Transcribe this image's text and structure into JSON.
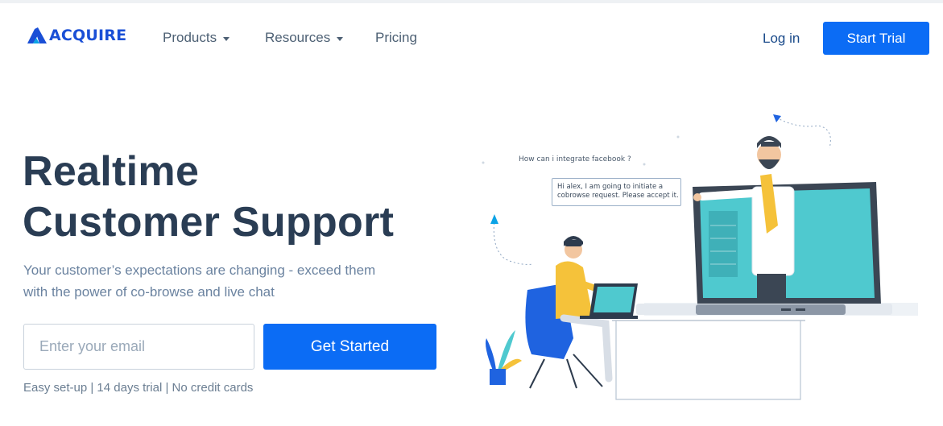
{
  "brand": {
    "logo_text": "ACQUIRE",
    "logo_icon": "acquire-logo-mark",
    "color": "#1a4fd6"
  },
  "nav": {
    "products": "Products",
    "resources": "Resources",
    "pricing": "Pricing",
    "login": "Log in",
    "start_trial": "Start Trial"
  },
  "hero": {
    "headline_line1": "Realtime",
    "headline_line2": "Customer Support",
    "subtitle_line1": "Your customer’s expectations are changing - exceed them",
    "subtitle_line2": "with the power of co-browse and live chat",
    "email_placeholder": "Enter your email",
    "cta": "Get Started",
    "footnote": "Easy set-up | 14 days trial | No credit cards"
  },
  "illustration": {
    "question": "How can i integrate facebook ?",
    "answer_line1": "Hi alex, I am going to initiate a",
    "answer_line2": "cobrowse request. Please accept it."
  },
  "colors": {
    "primary": "#0b6cf5",
    "heading": "#2a3d54",
    "muted": "#6b83a0",
    "screen": "#4fc9cf",
    "shirt_yellow": "#f5c23a",
    "chair_blue": "#1f63e0"
  }
}
